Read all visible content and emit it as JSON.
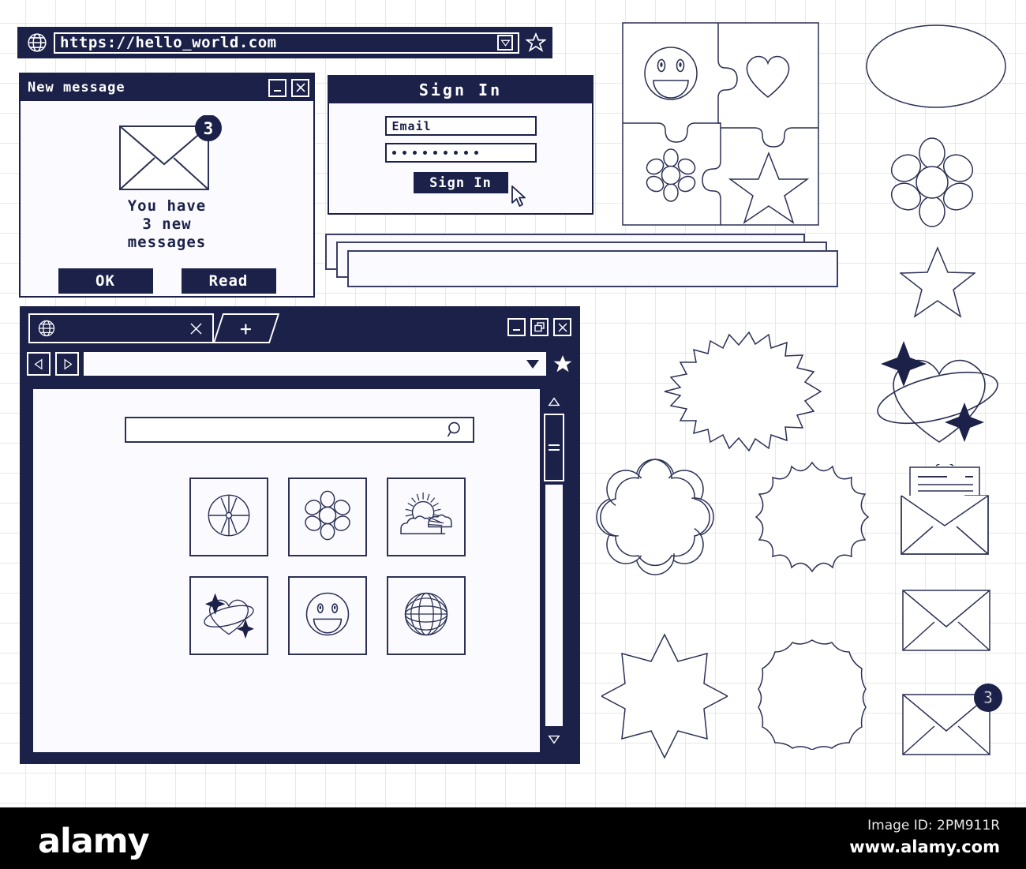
{
  "urlbar": {
    "icon": "globe-icon",
    "url": "https://hello_world.com",
    "dropdown_icon": "chevron-down-icon",
    "bookmark_icon": "star-icon"
  },
  "new_message_dialog": {
    "title": "New message",
    "minimize_label": "_",
    "close_label": "×",
    "badge_count": "3",
    "body_line1": "You have",
    "body_line2": "3 new",
    "body_line3": "messages",
    "ok_label": "OK",
    "read_label": "Read",
    "envelope_icon": "envelope-icon"
  },
  "sign_in_dialog": {
    "title": "Sign In",
    "email_placeholder": "Email",
    "password_masked": "•••••••••",
    "password_dot_count": 9,
    "submit_label": "Sign In",
    "cursor_icon": "mouse-pointer-icon"
  },
  "stacked_windows": {
    "count": 3
  },
  "browser": {
    "tab": {
      "icon": "globe-icon",
      "title": "",
      "close_label": "×"
    },
    "new_tab_label": "+",
    "window_controls": {
      "minimize": "_",
      "restore": "restore-icon",
      "close": "×"
    },
    "nav": {
      "back_icon": "triangle-left-icon",
      "forward_icon": "triangle-right-icon",
      "address_value": "",
      "address_dropdown_icon": "caret-down-icon",
      "bookmark_icon": "star-filled-icon"
    },
    "page": {
      "search_value": "",
      "search_icon": "magnifier-icon",
      "grid_items": [
        {
          "icon": "beach-ball-icon",
          "label": ""
        },
        {
          "icon": "flower-icon",
          "label": ""
        },
        {
          "icon": "sun-cloud-weather-icon",
          "label": ""
        },
        {
          "icon": "heart-orbit-sparkle-icon",
          "label": ""
        },
        {
          "icon": "smiley-face-icon",
          "label": ""
        },
        {
          "icon": "globe-wireframe-icon",
          "label": ""
        }
      ]
    },
    "scrollbar": {
      "up_icon": "triangle-up-icon",
      "thumb_icon": "grip-lines-icon",
      "down_icon": "triangle-down-icon"
    }
  },
  "decorative_shapes": [
    {
      "name": "puzzle-four-pieces",
      "contains": [
        "smiley-face",
        "heart",
        "flower",
        "star"
      ]
    },
    {
      "name": "ellipse-outline"
    },
    {
      "name": "flower-outline"
    },
    {
      "name": "five-point-star-outline"
    },
    {
      "name": "heart-with-orbit-and-sparkles"
    },
    {
      "name": "spiky-burst-oval"
    },
    {
      "name": "cloud-scallop-round"
    },
    {
      "name": "comic-burst-round"
    },
    {
      "name": "ten-point-star-burst"
    },
    {
      "name": "wavy-circle-seal"
    },
    {
      "name": "open-envelope-with-letter"
    },
    {
      "name": "closed-envelope"
    },
    {
      "name": "envelope-with-badge",
      "badge": "3"
    }
  ],
  "footer": {
    "logo": "alamy",
    "image_id": "Image ID: 2PM911R",
    "url": "www.alamy.com"
  },
  "colors": {
    "navy": "#1b2149",
    "line": "#2b3054",
    "paper": "#fafaff",
    "grid": "#e8e8ec"
  }
}
